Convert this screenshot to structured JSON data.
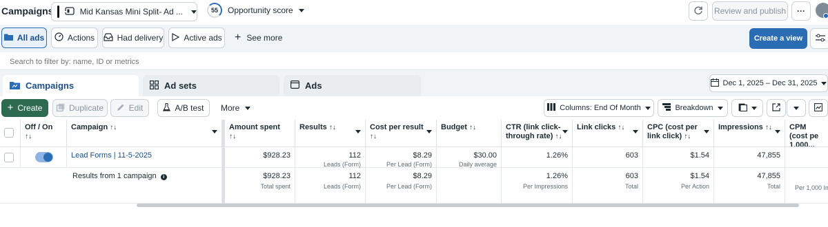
{
  "header": {
    "title": "Campaigns",
    "account_name": "Mid Kansas Mini Split- Ad ...",
    "opportunity_score_value": "55",
    "opportunity_score_label": "Opportunity score",
    "review_publish": "Review and publish",
    "more_dots": "···"
  },
  "filters": {
    "all_ads": "All ads",
    "actions": "Actions",
    "had_delivery": "Had delivery",
    "active_ads": "Active ads",
    "see_more": "See more",
    "create_view": "Create a view"
  },
  "search": {
    "placeholder": "Search to filter by: name, ID or metrics"
  },
  "tabs": [
    {
      "label": "Campaigns"
    },
    {
      "label": "Ad sets"
    },
    {
      "label": "Ads"
    }
  ],
  "date_range": "Dec 1, 2025 – Dec 31, 2025",
  "toolbar": {
    "create": "Create",
    "duplicate": "Duplicate",
    "edit": "Edit",
    "ab_test": "A/B test",
    "more": "More",
    "columns": "Columns: End Of Month",
    "breakdown": "Breakdown"
  },
  "table": {
    "headers": {
      "off_on": "Off / On",
      "campaign": "Campaign",
      "amount_spent": "Amount spent",
      "results": "Results",
      "cost_per_result": "Cost per result",
      "budget": "Budget",
      "ctr": "CTR (link click-through rate)",
      "link_clicks": "Link clicks",
      "cpc": "CPC (cost per link click)",
      "impressions": "Impressions",
      "cpm": "CPM (cost pe 1,000..."
    },
    "row": {
      "campaign_name": "Lead Forms | 11-5-2025",
      "amount_spent": "$928.23",
      "results": "112",
      "results_sub": "Leads (Form)",
      "cost_per_result": "$8.29",
      "cost_per_result_sub": "Per Lead (Form)",
      "budget": "$30.00",
      "budget_sub": "Daily average",
      "ctr": "1.26%",
      "link_clicks": "603",
      "cpc": "$1.54",
      "impressions": "47,855",
      "toggle_on": true
    },
    "summary": {
      "label": "Results from 1 campaign",
      "amount_spent": "$928.23",
      "amount_spent_sub": "Total spent",
      "results": "112",
      "results_sub": "Leads (Form)",
      "cost_per_result": "$8.29",
      "cost_per_result_sub": "Per Lead (Form)",
      "ctr": "1.26%",
      "ctr_sub": "Per Impressions",
      "link_clicks": "603",
      "link_clicks_sub": "Total",
      "cpc": "$1.54",
      "cpc_sub": "Per Action",
      "impressions": "47,855",
      "impressions_sub": "Total",
      "cpm_sub": "Per 1,000 Im"
    }
  },
  "sort_glyph": "↑↓",
  "colors": {
    "primary_blue": "#2a6db5",
    "create_green": "#2d6a4f",
    "link_blue": "#1a4f8b"
  }
}
